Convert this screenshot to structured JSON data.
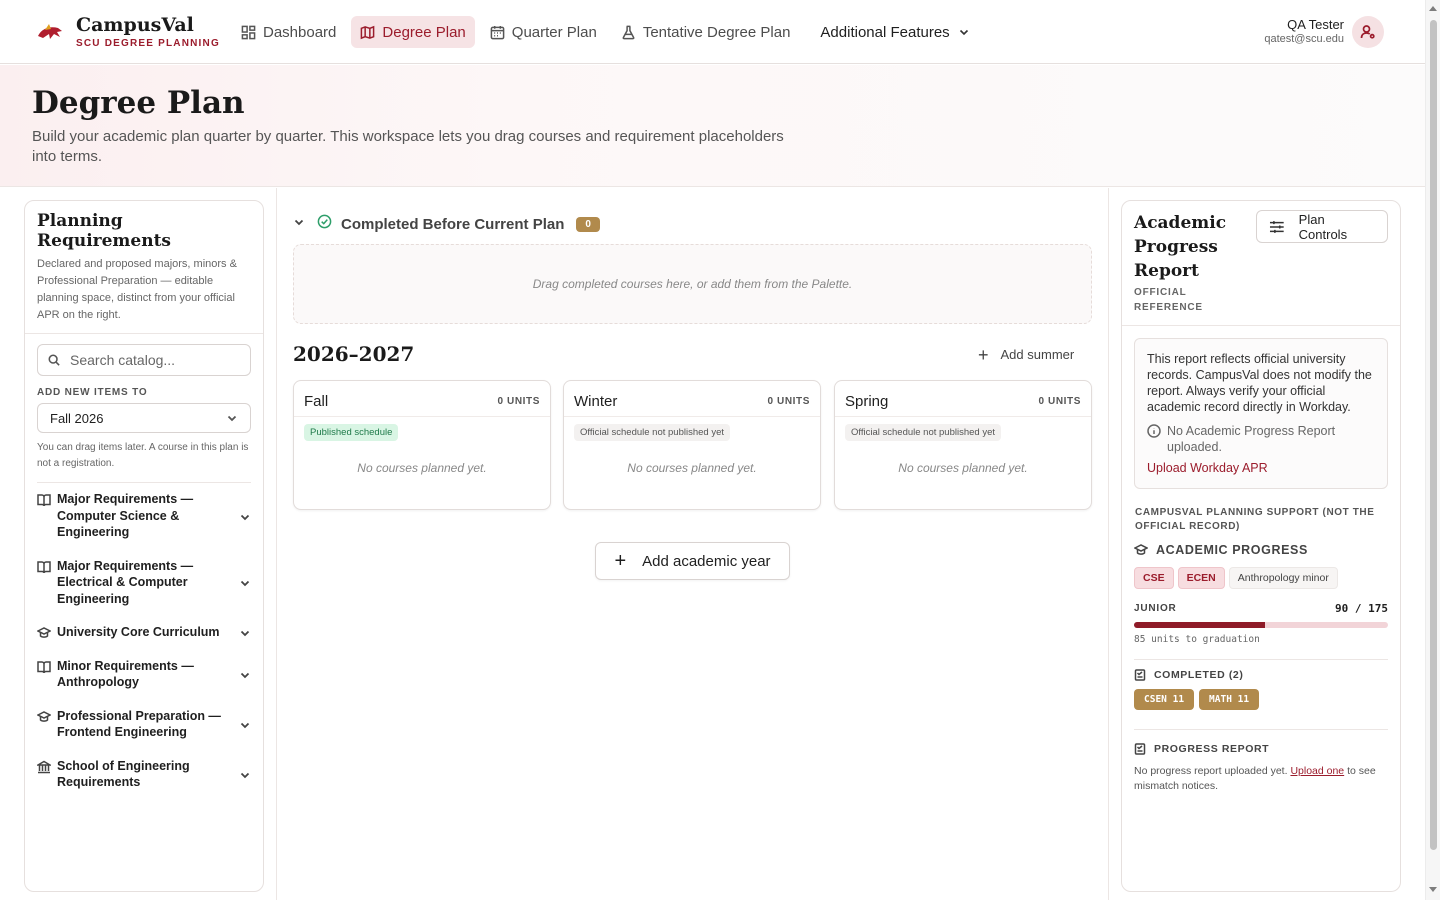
{
  "brand": {
    "name": "CampusVal",
    "subtitle": "SCU DEGREE PLANNING",
    "logo_icon": "bronco-logo-icon",
    "accent": "#9b1c2c"
  },
  "nav": {
    "items": [
      {
        "label": "Dashboard",
        "icon": "grid-icon"
      },
      {
        "label": "Degree Plan",
        "icon": "map-icon",
        "active": true
      },
      {
        "label": "Quarter Plan",
        "icon": "calendar-icon"
      },
      {
        "label": "Tentative Degree Plan",
        "icon": "flask-icon"
      }
    ],
    "more_label": "Additional Features"
  },
  "user": {
    "name": "QA Tester",
    "email": "qatest@scu.edu"
  },
  "hero": {
    "title": "Degree Plan",
    "description": "Build your academic plan quarter by quarter. This workspace lets you drag courses and requirement placeholders into terms."
  },
  "left_panel": {
    "title": "Planning Requirements",
    "description": "Declared and proposed majors, minors & Professional Preparation — editable planning space, distinct from your official APR on the right.",
    "search_placeholder": "Search catalog...",
    "add_label": "ADD NEW ITEMS TO",
    "term_select": "Fall 2026",
    "note": "You can drag items later. A course in this plan is not a registration.",
    "requirements": [
      {
        "label": "Major Requirements — Computer Science & Engineering",
        "icon": "book-icon"
      },
      {
        "label": "Major Requirements — Electrical & Computer Engineering",
        "icon": "book-icon"
      },
      {
        "label": "University Core Curriculum",
        "icon": "graduation-cap-icon"
      },
      {
        "label": "Minor Requirements — Anthropology",
        "icon": "book-icon"
      },
      {
        "label": "Professional Preparation — Frontend Engineering",
        "icon": "graduation-cap-icon"
      },
      {
        "label": "School of Engineering Requirements",
        "icon": "building-icon"
      }
    ]
  },
  "center": {
    "completed_title": "Completed Before Current Plan",
    "completed_count": "0",
    "dropzone_text": "Drag completed courses here, or add them from the Palette.",
    "year_title": "2026–2027",
    "add_summer": "Add summer",
    "terms": [
      {
        "name": "Fall",
        "units": "0 UNITS",
        "badge": "Published schedule",
        "published": true,
        "empty": "No courses planned yet."
      },
      {
        "name": "Winter",
        "units": "0 UNITS",
        "badge": "Official schedule not published yet",
        "published": false,
        "empty": "No courses planned yet."
      },
      {
        "name": "Spring",
        "units": "0 UNITS",
        "badge": "Official schedule not published yet",
        "published": false,
        "empty": "No courses planned yet."
      }
    ],
    "add_year": "Add academic year"
  },
  "right_panel": {
    "title": "Academic Progress Report",
    "subtitle": "OFFICIAL REFERENCE",
    "plan_controls": "Plan Controls",
    "notice": "This report reflects official university records. CampusVal does not modify the report. Always verify your official academic record directly in Workday.",
    "warning": "No Academic Progress Report uploaded.",
    "upload_link": "Upload Workday APR",
    "support_label": "CAMPUSVAL PLANNING SUPPORT (NOT THE OFFICIAL RECORD)",
    "academic_progress": "ACADEMIC PROGRESS",
    "programs": [
      {
        "label": "CSE",
        "kind": "major"
      },
      {
        "label": "ECEN",
        "kind": "major"
      },
      {
        "label": "Anthropology minor",
        "kind": "minor"
      }
    ],
    "level": "JUNIOR",
    "units_text": "90 / 175",
    "units_completed": 90,
    "units_required": 175,
    "units_to_grad": "85 units to graduation",
    "completed_label": "COMPLETED (2)",
    "completed_courses": [
      "CSEN 11",
      "MATH 11"
    ],
    "progress_report_label": "PROGRESS REPORT",
    "no_report_prefix": "No progress report uploaded yet.",
    "no_report_link": "Upload one",
    "no_report_suffix": "to see mismatch notices."
  }
}
